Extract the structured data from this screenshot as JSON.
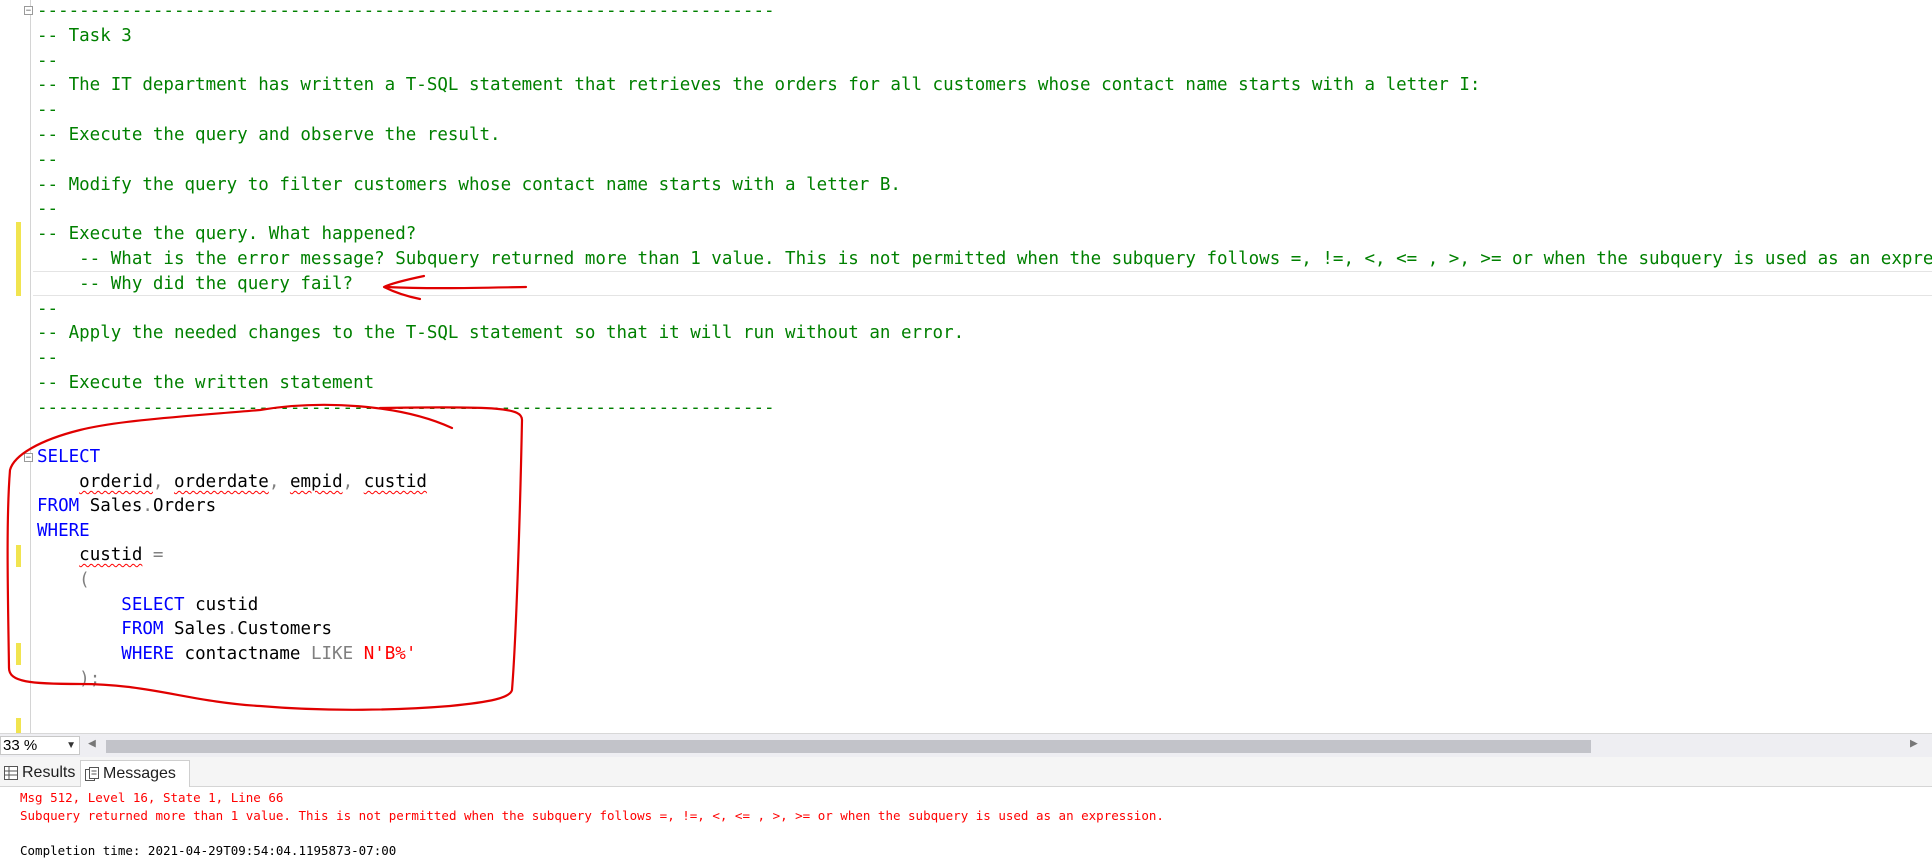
{
  "editor": {
    "lines": [
      {
        "text": "----------------------------------------------------------------------",
        "class": "cmt"
      },
      {
        "text": "-- Task 3",
        "class": "cmt"
      },
      {
        "text": "--",
        "class": "cmt"
      },
      {
        "text": "-- The IT department has written a T-SQL statement that retrieves the orders for all customers whose contact name starts with a letter I:",
        "class": "cmt"
      },
      {
        "text": "--",
        "class": "cmt"
      },
      {
        "text": "-- Execute the query and observe the result.",
        "class": "cmt"
      },
      {
        "text": "--",
        "class": "cmt"
      },
      {
        "text": "-- Modify the query to filter customers whose contact name starts with a letter B.",
        "class": "cmt"
      },
      {
        "text": "--",
        "class": "cmt"
      },
      {
        "text": "-- Execute the query. What happened?",
        "class": "cmt"
      },
      {
        "text": "    -- What is the error message? Subquery returned more than 1 value. This is not permitted when the subquery follows =, !=, <, <= , >, >= or when the subquery is used as an expression.",
        "class": "cmt"
      },
      {
        "text": "    -- Why did the query fail?",
        "class": "cmt"
      },
      {
        "text": "--",
        "class": "cmt"
      },
      {
        "text": "-- Apply the needed changes to the T-SQL statement so that it will run without an error.",
        "class": "cmt"
      },
      {
        "text": "--",
        "class": "cmt"
      },
      {
        "text": "-- Execute the written statement",
        "class": "cmt"
      },
      {
        "text": "----------------------------------------------------------------------",
        "class": "cmt"
      }
    ],
    "code": {
      "select1": "SELECT",
      "col_orderid": "orderid",
      "comma1": ",",
      "col_orderdate": "orderdate",
      "comma2": ",",
      "col_empid": "empid",
      "comma3": ",",
      "col_custid": "custid",
      "from1": "FROM",
      "table1": "Sales",
      "dot1": ".",
      "table1b": "Orders",
      "where1": "WHERE",
      "where_col": "custid",
      "eq": "=",
      "lparen": "(",
      "select2": "SELECT",
      "sub_col": "custid",
      "from2": "FROM",
      "table2": "Sales",
      "dot2": ".",
      "table2b": "Customers",
      "where2": "WHERE",
      "filter_col": "contactname",
      "like": "LIKE",
      "pattern": "N'B%'",
      "rparen": ");"
    }
  },
  "toolbar": {
    "zoom_value": "33 %"
  },
  "tabs": {
    "results_label": "Results",
    "messages_label": "Messages"
  },
  "messages": {
    "line1": "Msg 512, Level 16, State 1, Line 66",
    "line2": "Subquery returned more than 1 value. This is not permitted when the subquery follows =, !=, <, <= , >, >= or when the subquery is used as an expression.",
    "line3": "Completion time: 2021-04-29T09:54:04.1195873-07:00"
  },
  "colors": {
    "comment": "#008000",
    "keyword": "#0000ff",
    "string": "#ff0000",
    "annotation": "#e00000"
  }
}
